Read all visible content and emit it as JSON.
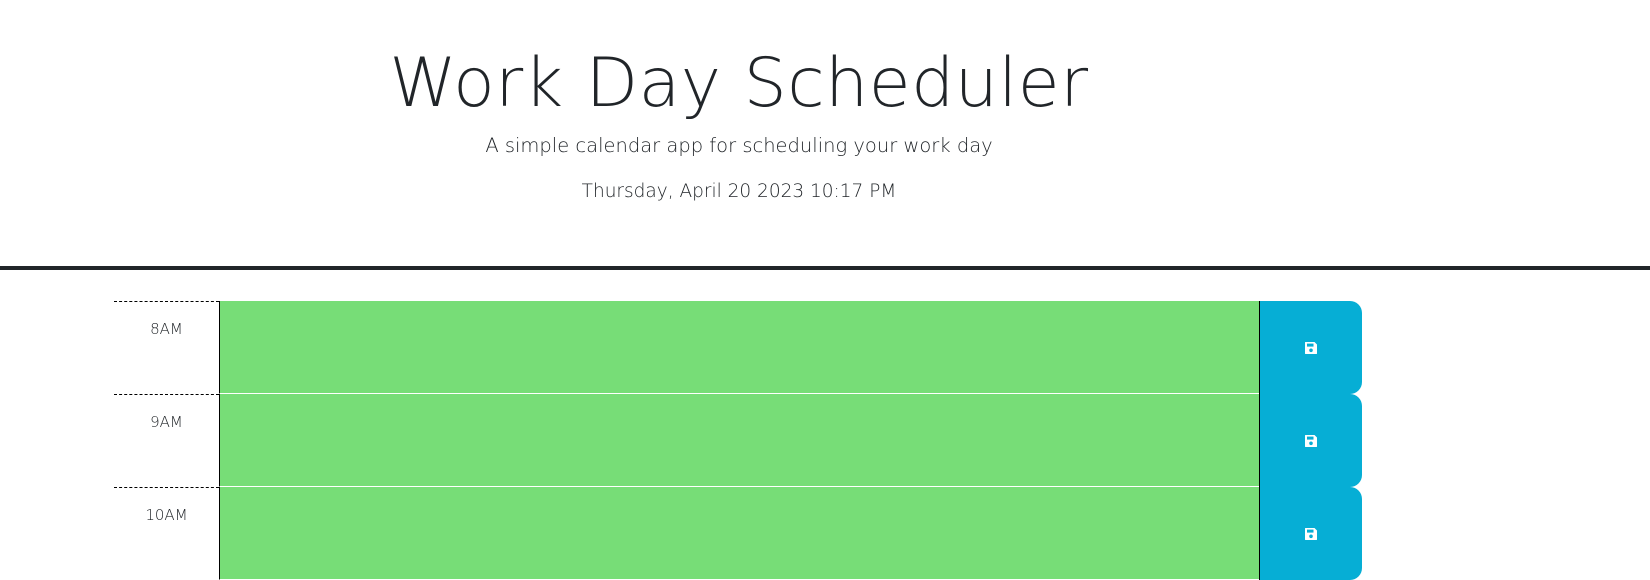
{
  "header": {
    "title": "Work Day Scheduler",
    "lead": "A simple calendar app for scheduling your work day",
    "current_day": "Thursday, April 20 2023 10:17 PM"
  },
  "time_blocks": [
    {
      "hour": "8AM",
      "description": "",
      "status": "future",
      "save_icon": "save-icon"
    },
    {
      "hour": "9AM",
      "description": "",
      "status": "future",
      "save_icon": "save-icon"
    },
    {
      "hour": "10AM",
      "description": "",
      "status": "future",
      "save_icon": "save-icon"
    }
  ],
  "colors": {
    "future": "#77dd77",
    "save_button": "#06aed5",
    "header_border": "#212529"
  }
}
